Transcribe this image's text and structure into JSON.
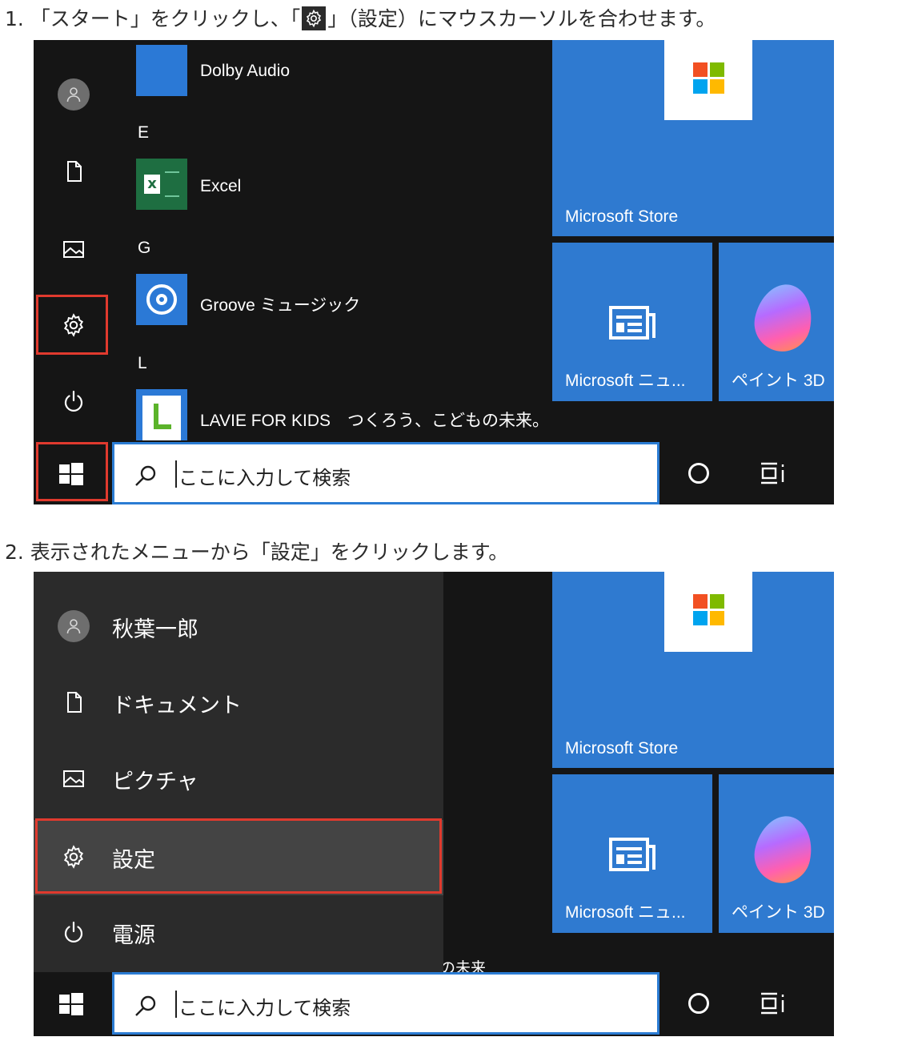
{
  "step1": {
    "prefix": "1. 「スタート」をクリックし、「",
    "suffix": "」（設定）にマウスカーソルを合わせます。",
    "icon": "gear-icon"
  },
  "step2": {
    "text": "2. 表示されたメニューから「設定」をクリックします。"
  },
  "app_list": [
    {
      "letter": "",
      "name": "Dolby Audio",
      "icon": "dolby-audio-tile-icon",
      "color": "#2b79d6"
    },
    {
      "letter": "E",
      "name": "Excel",
      "icon": "excel-icon",
      "color": "#1f7244"
    },
    {
      "letter": "G",
      "name": "Groove ミュージック",
      "icon": "groove-music-icon",
      "color": "#2b79d6"
    },
    {
      "letter": "L",
      "name": "LAVIE FOR KIDS　つくろう、こどもの未来。",
      "icon": "lavie-kids-icon",
      "color": "#2b79d6"
    }
  ],
  "tiles": {
    "store": "Microsoft Store",
    "news": "Microsoft ニュ...",
    "paint3d": "ペイント 3D"
  },
  "taskbar": {
    "search_placeholder": "ここに入力して検索"
  },
  "menu": {
    "items": [
      {
        "label": "秋葉一郎",
        "icon": "user-avatar-icon"
      },
      {
        "label": "ドキュメント",
        "icon": "document-icon"
      },
      {
        "label": "ピクチャ",
        "icon": "pictures-icon"
      },
      {
        "label": "設定",
        "icon": "gear-icon",
        "selected": true
      },
      {
        "label": "電源",
        "icon": "power-icon"
      }
    ],
    "behind_text": "の未来"
  },
  "colors": {
    "accent_blue": "#2f7ad0",
    "highlight_red": "#e03a2e",
    "start_background": "#151515",
    "menu_background": "#2b2b2b",
    "selected_background": "#444444"
  }
}
